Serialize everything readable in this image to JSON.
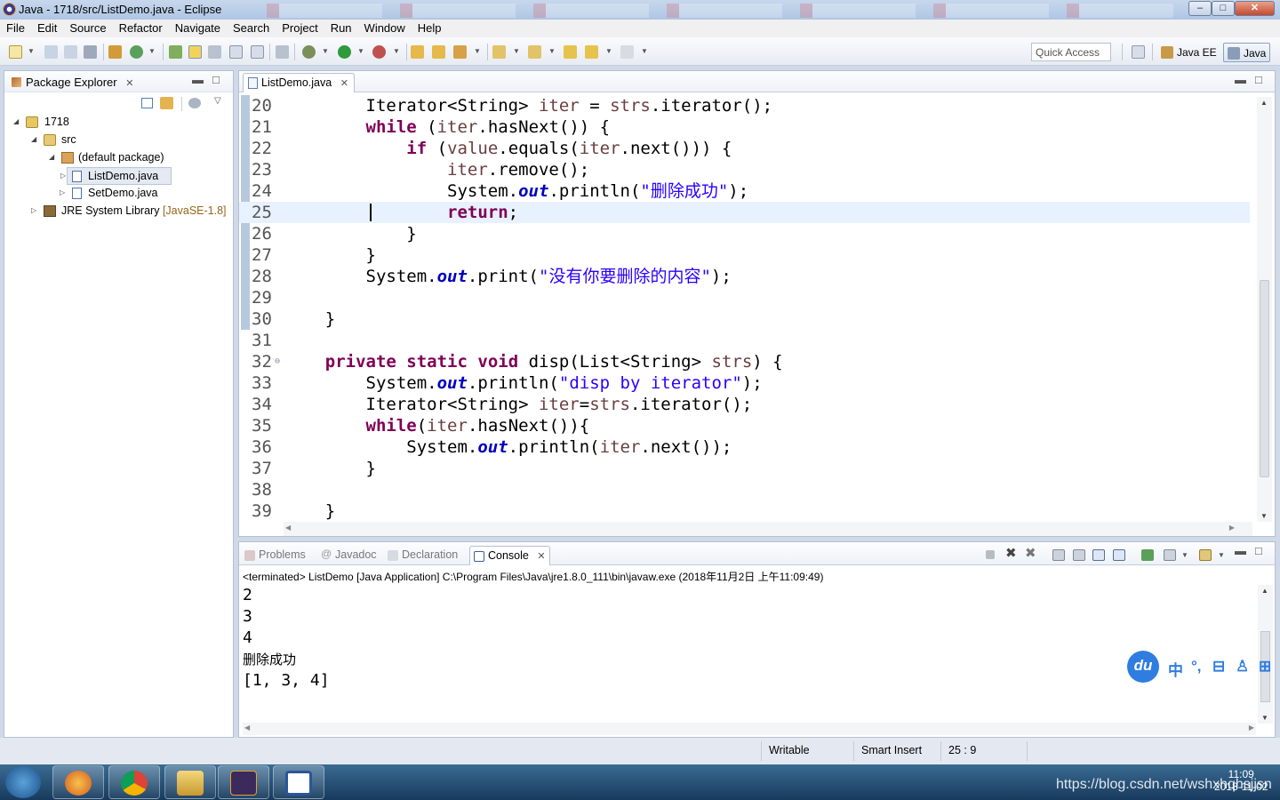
{
  "window": {
    "title": "Java - 1718/src/ListDemo.java - Eclipse",
    "minimize_glyph": "–",
    "maximize_glyph": "□",
    "close_glyph": "✕"
  },
  "menu": [
    "File",
    "Edit",
    "Source",
    "Refactor",
    "Navigate",
    "Search",
    "Project",
    "Run",
    "Window",
    "Help"
  ],
  "toolbar": {
    "quick_access_placeholder": "Quick Access",
    "perspectives": [
      {
        "label": "Java EE",
        "icon": "java-ee-perspective-icon"
      },
      {
        "label": "Java",
        "icon": "java-perspective-icon",
        "active": true
      }
    ]
  },
  "package_explorer": {
    "tab_label": "Package Explorer",
    "close_glyph": "✕",
    "tree": [
      {
        "label": "1718",
        "icon": "project-icon",
        "expanded": true,
        "depth": 0
      },
      {
        "label": "src",
        "icon": "source-folder-icon",
        "expanded": true,
        "depth": 1
      },
      {
        "label": "(default package)",
        "icon": "package-icon",
        "expanded": true,
        "depth": 2
      },
      {
        "label": "ListDemo.java",
        "icon": "java-file-icon",
        "selected": true,
        "depth": 3
      },
      {
        "label": "SetDemo.java",
        "icon": "java-file-icon",
        "depth": 3
      },
      {
        "label": "JRE System Library",
        "suffix": "[JavaSE-1.8]",
        "icon": "library-icon",
        "depth": 1
      }
    ]
  },
  "editor": {
    "tab_label": "ListDemo.java",
    "close_glyph": "✕",
    "current_line": 25,
    "lines": [
      {
        "n": "20",
        "tokens": [
          [
            "",
            "        "
          ],
          [
            "",
            "Iterator<String> "
          ],
          [
            "var",
            "iter"
          ],
          [
            "",
            " = "
          ],
          [
            "var",
            "strs"
          ],
          [
            "",
            ".iterator();"
          ]
        ]
      },
      {
        "n": "21",
        "tokens": [
          [
            "",
            "        "
          ],
          [
            "kw",
            "while"
          ],
          [
            "",
            " ("
          ],
          [
            "var",
            "iter"
          ],
          [
            "",
            ".hasNext()) {"
          ]
        ]
      },
      {
        "n": "22",
        "tokens": [
          [
            "",
            "            "
          ],
          [
            "kw",
            "if"
          ],
          [
            "",
            " ("
          ],
          [
            "var",
            "value"
          ],
          [
            "",
            ".equals("
          ],
          [
            "var",
            "iter"
          ],
          [
            "",
            ".next())) {"
          ]
        ]
      },
      {
        "n": "23",
        "tokens": [
          [
            "",
            "                "
          ],
          [
            "var",
            "iter"
          ],
          [
            "",
            ".remove();"
          ]
        ]
      },
      {
        "n": "24",
        "tokens": [
          [
            "",
            "                System."
          ],
          [
            "fld",
            "out"
          ],
          [
            "",
            ".println("
          ],
          [
            "str",
            "\"删除成功\""
          ],
          [
            "",
            ");"
          ]
        ]
      },
      {
        "n": "25",
        "tokens": [
          [
            "",
            "                "
          ],
          [
            "kw",
            "return"
          ],
          [
            "",
            ";"
          ]
        ]
      },
      {
        "n": "26",
        "tokens": [
          [
            "",
            "            }"
          ]
        ]
      },
      {
        "n": "27",
        "tokens": [
          [
            "",
            "        }"
          ]
        ]
      },
      {
        "n": "28",
        "tokens": [
          [
            "",
            "        System."
          ],
          [
            "fld",
            "out"
          ],
          [
            "",
            ".print("
          ],
          [
            "str",
            "\"没有你要删除的内容\""
          ],
          [
            "",
            ");"
          ]
        ]
      },
      {
        "n": "29",
        "tokens": [
          [
            "",
            ""
          ]
        ]
      },
      {
        "n": "30",
        "tokens": [
          [
            "",
            "    }"
          ]
        ]
      },
      {
        "n": "31",
        "tokens": [
          [
            "",
            ""
          ]
        ]
      },
      {
        "n": "32",
        "fold": true,
        "tokens": [
          [
            "",
            "    "
          ],
          [
            "kw",
            "private"
          ],
          [
            "",
            " "
          ],
          [
            "kw",
            "static"
          ],
          [
            "",
            " "
          ],
          [
            "kw",
            "void"
          ],
          [
            "",
            " disp(List<String> "
          ],
          [
            "var",
            "strs"
          ],
          [
            "",
            ") {"
          ]
        ]
      },
      {
        "n": "33",
        "tokens": [
          [
            "",
            "        System."
          ],
          [
            "fld",
            "out"
          ],
          [
            "",
            ".println("
          ],
          [
            "str",
            "\"disp by iterator\""
          ],
          [
            "",
            ");"
          ]
        ]
      },
      {
        "n": "34",
        "tokens": [
          [
            "",
            "        Iterator<String> "
          ],
          [
            "var",
            "iter"
          ],
          [
            "",
            "="
          ],
          [
            "var",
            "strs"
          ],
          [
            "",
            ".iterator();"
          ]
        ]
      },
      {
        "n": "35",
        "tokens": [
          [
            "",
            "        "
          ],
          [
            "kw",
            "while"
          ],
          [
            "",
            "("
          ],
          [
            "var",
            "iter"
          ],
          [
            "",
            ".hasNext()){"
          ]
        ]
      },
      {
        "n": "36",
        "tokens": [
          [
            "",
            "            System."
          ],
          [
            "fld",
            "out"
          ],
          [
            "",
            ".println("
          ],
          [
            "var",
            "iter"
          ],
          [
            "",
            ".next());"
          ]
        ]
      },
      {
        "n": "37",
        "tokens": [
          [
            "",
            "        }"
          ]
        ]
      },
      {
        "n": "38",
        "tokens": [
          [
            "",
            ""
          ]
        ]
      },
      {
        "n": "39",
        "tokens": [
          [
            "",
            "    }"
          ]
        ]
      }
    ]
  },
  "console": {
    "tabs": [
      {
        "label": "Problems",
        "icon": "problems-icon"
      },
      {
        "label": "Javadoc",
        "icon": "javadoc-icon"
      },
      {
        "label": "Declaration",
        "icon": "declaration-icon"
      },
      {
        "label": "Console",
        "icon": "console-icon",
        "active": true
      }
    ],
    "close_glyph": "✕",
    "status": "<terminated> ListDemo [Java Application] C:\\Program Files\\Java\\jre1.8.0_111\\bin\\javaw.exe (2018年11月2日 上午11:09:49)",
    "output": [
      "2",
      "3",
      "4",
      "删除成功",
      "[1, 3, 4]"
    ]
  },
  "ime": {
    "logo": "du",
    "items": [
      "中",
      "°,",
      "⊟",
      "♙",
      "⊞"
    ]
  },
  "statusbar": {
    "writable": "Writable",
    "insert_mode": "Smart Insert",
    "position": "25 : 9"
  },
  "taskbar": {
    "apps": [
      "firefox-icon",
      "chrome-icon",
      "explorer-icon",
      "eclipse-javaee-icon",
      "word-icon"
    ],
    "watermark": "https://blog.csdn.net/wshxhqhsjjsn",
    "time": "11:09",
    "date": "2018-11-02"
  },
  "colors": {
    "keyword": "#7f0055",
    "string": "#2a00ff",
    "field": "#0000c0",
    "variable": "#6a3e3e",
    "current_line": "#e8f2fe"
  }
}
